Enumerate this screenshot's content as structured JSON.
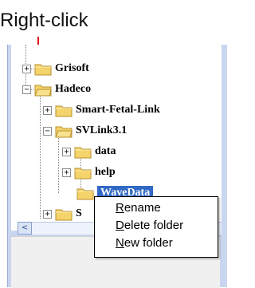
{
  "annotation": {
    "text": "Right-click"
  },
  "tree": {
    "items": [
      {
        "label": "Grisoft",
        "expander": "+"
      },
      {
        "label": "Hadeco",
        "expander": "−"
      },
      {
        "label": "Smart-Fetal-Link",
        "expander": "+"
      },
      {
        "label": "SVLink3.1",
        "expander": "−"
      },
      {
        "label": "data",
        "expander": "+"
      },
      {
        "label": "help",
        "expander": "+"
      },
      {
        "label": "WaveData",
        "expander": ""
      },
      {
        "label": "S",
        "expander": "+"
      }
    ]
  },
  "context_menu": {
    "items": [
      {
        "label_prefix": "",
        "mnemonic": "R",
        "label_suffix": "ename"
      },
      {
        "label_prefix": "",
        "mnemonic": "D",
        "label_suffix": "elete folder"
      },
      {
        "label_prefix": "",
        "mnemonic": "N",
        "label_suffix": "ew folder"
      }
    ]
  },
  "scrollbar": {
    "left_arrow": "<"
  },
  "colors": {
    "accent": "#e30613",
    "selection": "#316ac5",
    "folder_fill": "#f5d36b",
    "folder_edge": "#b8902f"
  }
}
